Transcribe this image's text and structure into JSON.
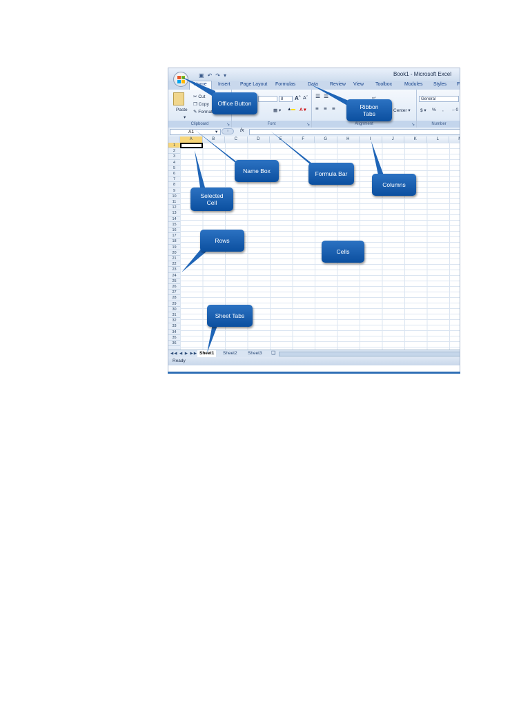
{
  "window": {
    "title": "Book1 - Microsoft Excel",
    "office_button_icon": "office-logo-icon"
  },
  "tabs": [
    "Home",
    "Insert",
    "Page Layout",
    "Formulas",
    "Data",
    "Review",
    "View",
    "Toolbox",
    "Modules",
    "Styles",
    "F"
  ],
  "ribbon": {
    "clipboard": {
      "paste": "Paste",
      "cut": "Cut",
      "copy": "Copy",
      "format": "Format",
      "label": "Clipboard"
    },
    "font": {
      "size": "8",
      "label": "Font"
    },
    "alignment": {
      "center": "Center",
      "label": "Alignment"
    },
    "number": {
      "format": "General",
      "currency": "$",
      "percent": "%",
      "comma": ",",
      "label": "Number"
    }
  },
  "formula_bar": {
    "name_box": "A1",
    "fx": "fx"
  },
  "columns": [
    "A",
    "B",
    "C",
    "D",
    "E",
    "F",
    "G",
    "H",
    "I",
    "J",
    "K",
    "L",
    "M"
  ],
  "rows": [
    "1",
    "2",
    "3",
    "4",
    "5",
    "6",
    "7",
    "8",
    "9",
    "10",
    "11",
    "12",
    "13",
    "14",
    "15",
    "16",
    "17",
    "18",
    "19",
    "20",
    "21",
    "22",
    "23",
    "24",
    "25",
    "26",
    "27",
    "28",
    "29",
    "30",
    "31",
    "32",
    "33",
    "34",
    "35",
    "36"
  ],
  "sheets": [
    "Sheet1",
    "Sheet2",
    "Sheet3"
  ],
  "status": "Ready",
  "callouts": {
    "office_button": "Office Button",
    "ribbon_tabs": "Ribbon\nTabs",
    "name_box": "Name Box",
    "formula_bar": "Formula Bar",
    "columns": "Columns",
    "selected_cell": "Selected\nCell",
    "rows": "Rows",
    "cells": "Cells",
    "sheet_tabs": "Sheet Tabs"
  },
  "colors": {
    "accent": "#0b4f9f",
    "selection": "#f7d67a",
    "bottom_rule": "#2f6fb5"
  }
}
